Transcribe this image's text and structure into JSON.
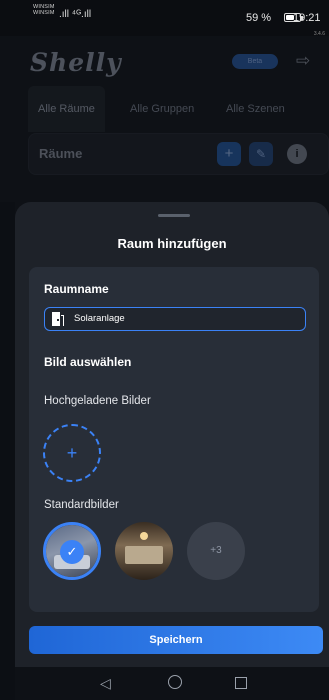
{
  "status_bar": {
    "carrier_1": "WINSIM",
    "carrier_2": "WINSIM",
    "signal": ".ıll ⁴ᴳ.ıll",
    "battery_percent": "59 %",
    "battery_level": 0.59,
    "time": "19:21",
    "version": "3.4.6"
  },
  "app": {
    "logo": "Shelly",
    "pill_label": "Beta",
    "tabs": [
      {
        "label": "Alle Räume"
      },
      {
        "label": "Alle Gruppen"
      },
      {
        "label": "Alle Szenen"
      }
    ],
    "rooms_title": "Räume",
    "icons": {
      "exit": "exit-icon",
      "add": "plus-icon",
      "edit": "pencil-icon",
      "info": "info-icon"
    }
  },
  "dialog": {
    "title": "Raum hinzufügen",
    "name_label": "Raumname",
    "name_value": "Solaranlage",
    "image_label": "Bild auswählen",
    "uploaded_label": "Hochgeladene Bilder",
    "default_label": "Standardbilder",
    "more_count": "+3",
    "save_label": "Speichern",
    "accent_color": "#3b82f6"
  },
  "nav": {
    "back": "◁",
    "home": "home-icon",
    "recent": "recent-apps-icon"
  }
}
